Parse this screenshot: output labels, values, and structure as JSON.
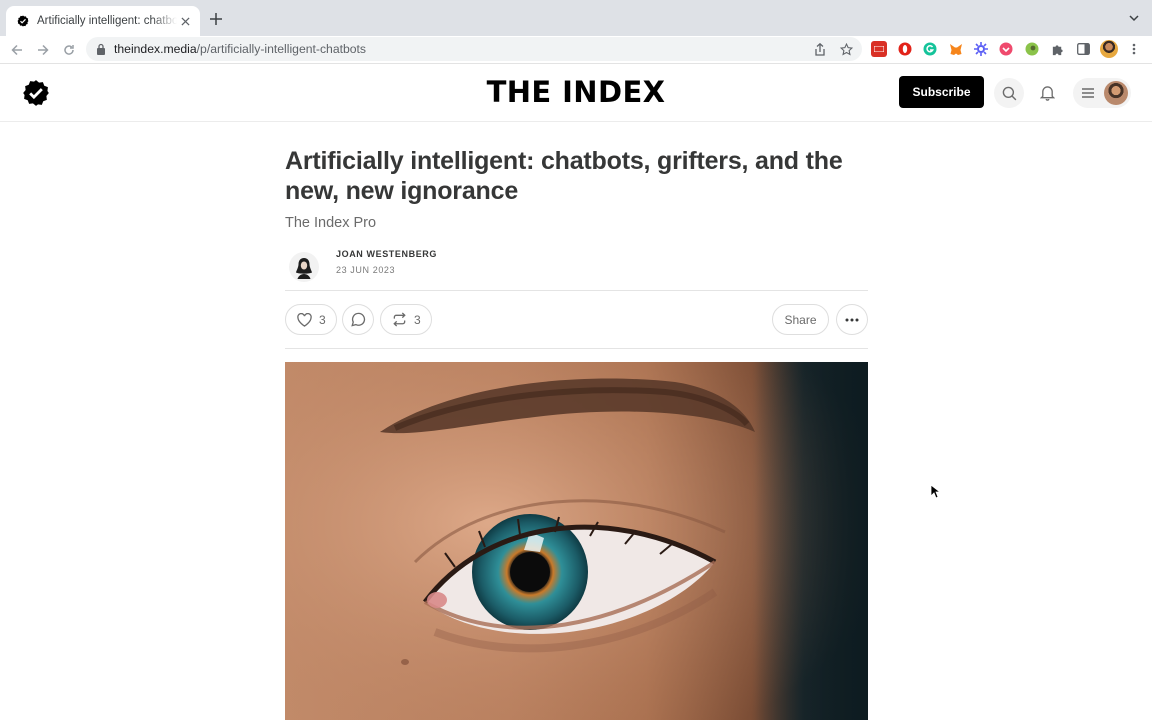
{
  "browser": {
    "tab": {
      "title": "Artificially intelligent: chatbots, grifters, and the new, new ignorance"
    },
    "address_bar": {
      "host": "theindex.media",
      "path": "/p/artificially-intelligent-chatbots"
    },
    "extension_colors": [
      "#d93025",
      "#e2231a",
      "#15c39a",
      "#f6851b",
      "#5b5ff5",
      "#ef4a6d",
      "#8bc34a"
    ]
  },
  "site": {
    "name": "THE INDEX",
    "subscribe_label": "Subscribe"
  },
  "article": {
    "title": "Artificially intelligent: chatbots, grifters, and the new, new ignorance",
    "subtitle": "The Index Pro",
    "author": "JOAN WESTENBERG",
    "date": "23 JUN 2023",
    "likes": "3",
    "restacks": "3",
    "share_label": "Share"
  },
  "colors": {
    "accent": "#000000",
    "text": "#363737",
    "muted": "#6b6b6b"
  }
}
